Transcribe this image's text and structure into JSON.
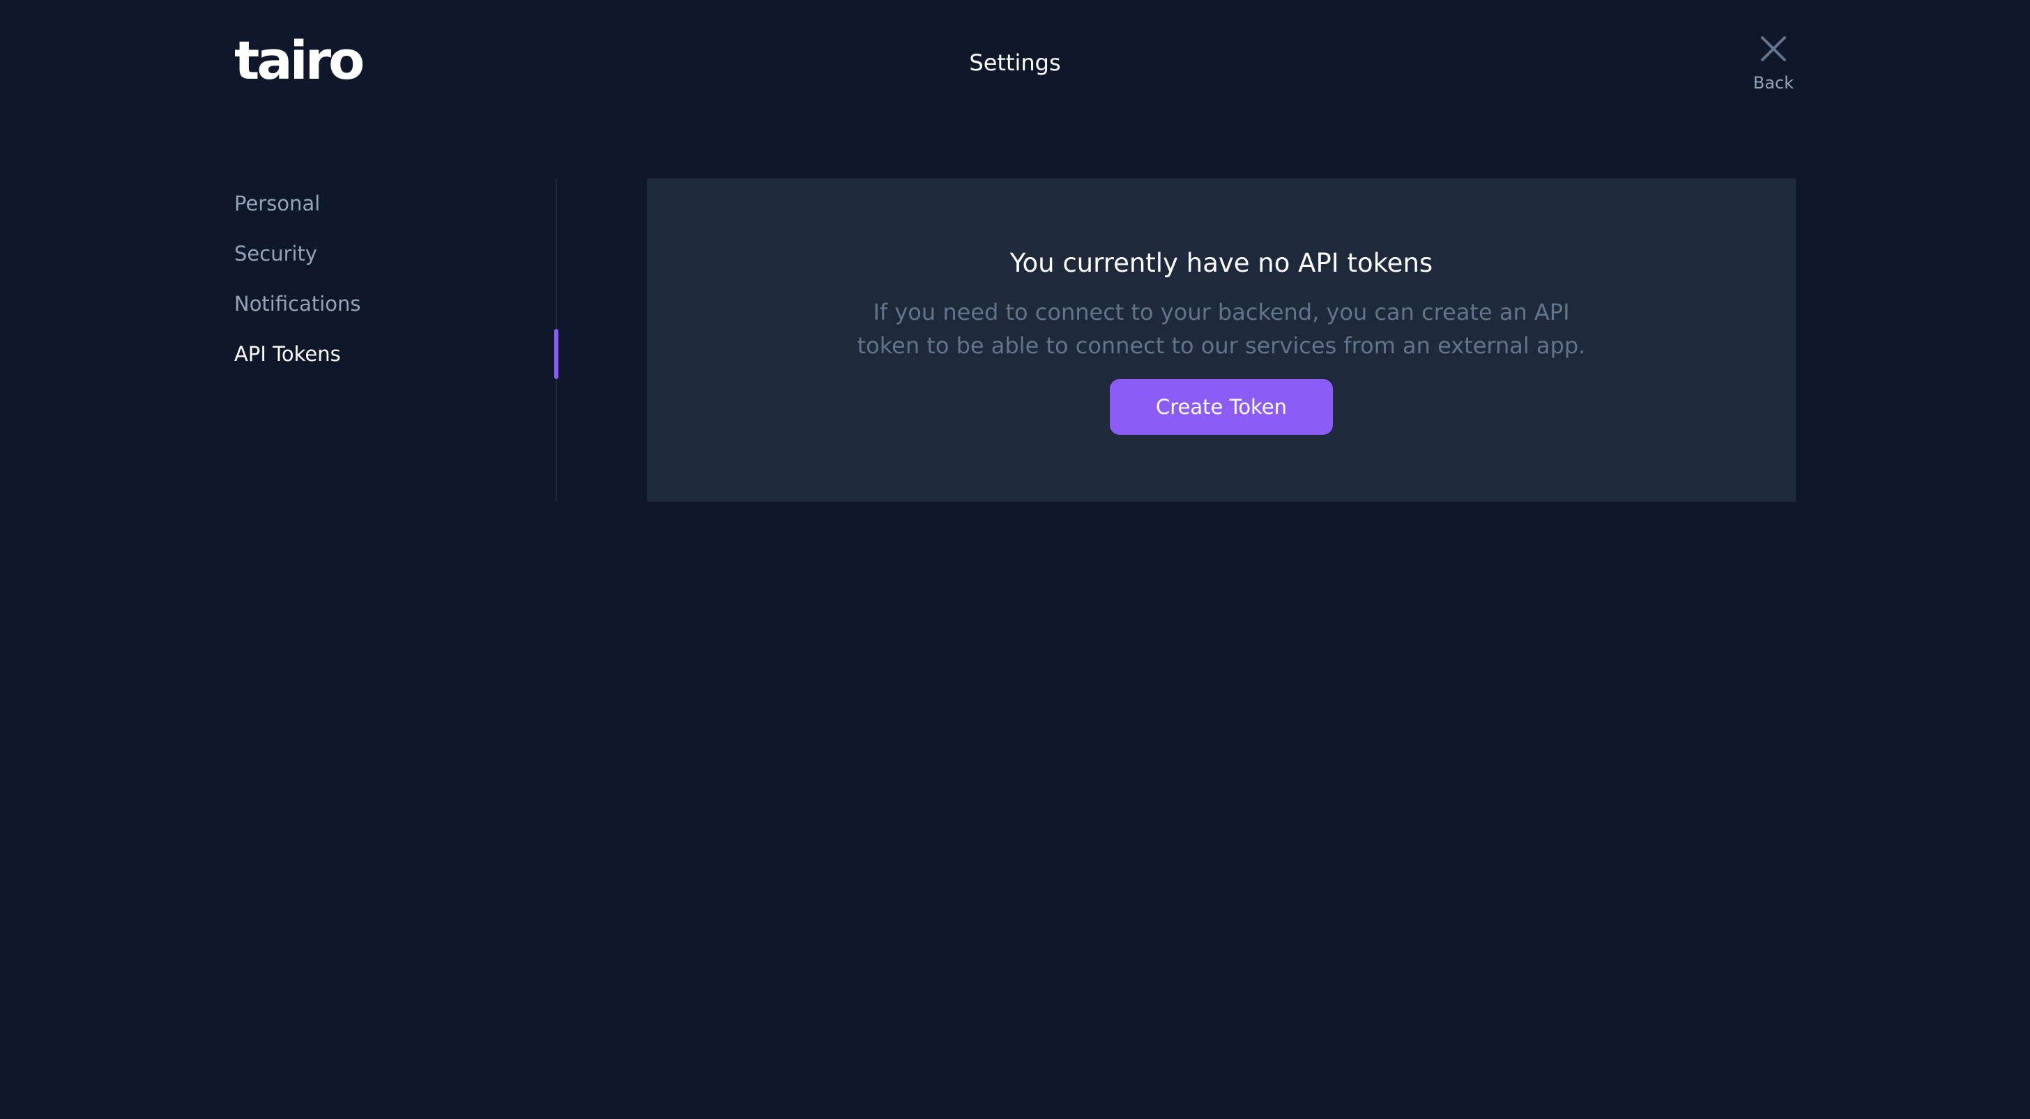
{
  "header": {
    "logo_text": "tairo",
    "title": "Settings",
    "back": {
      "icon": "close-icon",
      "label": "Back"
    }
  },
  "sidebar": {
    "items": [
      {
        "label": "Personal",
        "active": false
      },
      {
        "label": "Security",
        "active": false
      },
      {
        "label": "Notifications",
        "active": false
      },
      {
        "label": "API Tokens",
        "active": true
      }
    ]
  },
  "empty_state": {
    "heading": "You currently have no API tokens",
    "body_line_1": "If you need to connect to your backend, you can create an API",
    "body_line_2": "token to be able to connect to our services from an external app.",
    "button_label": "Create Token"
  },
  "colors": {
    "background": "#0f172a",
    "card": "#1e293b",
    "accent": "#8b5cf6",
    "muted_text": "#94a3b8",
    "body_text": "#64748b"
  }
}
